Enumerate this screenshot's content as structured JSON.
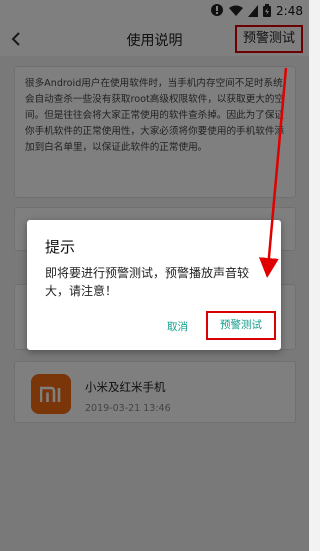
{
  "status": {
    "time": "2:48"
  },
  "appbar": {
    "title": "使用说明",
    "action_label": "预警测试"
  },
  "intro": {
    "text": "很多Android用户在使用软件时，当手机内存空间不足时系统会自动查杀一些没有获取root高级权限软件，以获取更大的空间。但是往往会将大家正常使用的软件查杀掉。因此为了保证你手机软件的正常使用性，大家必须将你要使用的手机软件添加到白名单里，以保证此软件的正常使用。"
  },
  "devices": [
    {
      "name": "小米及红米手机",
      "date": "2019-03-21 13:46",
      "logo_text": "mi"
    }
  ],
  "dialog": {
    "title": "提示",
    "message": "即将要进行预警测试，预警播放声音较大，请注意！",
    "cancel_label": "取消",
    "confirm_label": "预警测试"
  },
  "colors": {
    "highlight": "#d90000",
    "accent": "#0f9d8a",
    "mi_orange": "#f46a12"
  },
  "icons": {
    "back": "chevron-left-icon",
    "wifi": "wifi-icon",
    "battery": "battery-icon",
    "signal": "signal-icon"
  }
}
